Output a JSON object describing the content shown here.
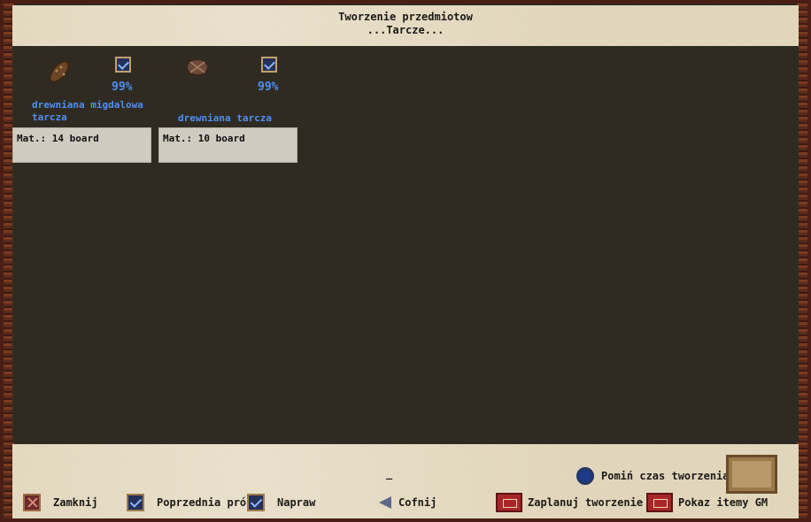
{
  "window": {
    "title": "Tworzenie przedmiotow",
    "subtitle": "...Tarcze..."
  },
  "items": [
    {
      "icon": "wooden-kite-shield-icon",
      "percent": "99%",
      "name_line1": "drewniana migdalowa",
      "name_line2": "tarcza",
      "materials": "Mat.: 14 board"
    },
    {
      "icon": "wooden-round-shield-icon",
      "percent": "99%",
      "name_line1": "drewniana tarcza",
      "name_line2": "",
      "materials": "Mat.: 10 board"
    }
  ],
  "footer": {
    "close_label": "Zamknij",
    "previous_try_label": "Poprzednia próba",
    "repair_label": "Napraw",
    "undo_label": "Cofnij",
    "schedule_label": "Zaplanuj tworzenie",
    "show_gm_items_label": "Pokaz itemy GM",
    "skip_time_label": "Pomiń czas tworzenia",
    "cursor_mark": "_"
  }
}
